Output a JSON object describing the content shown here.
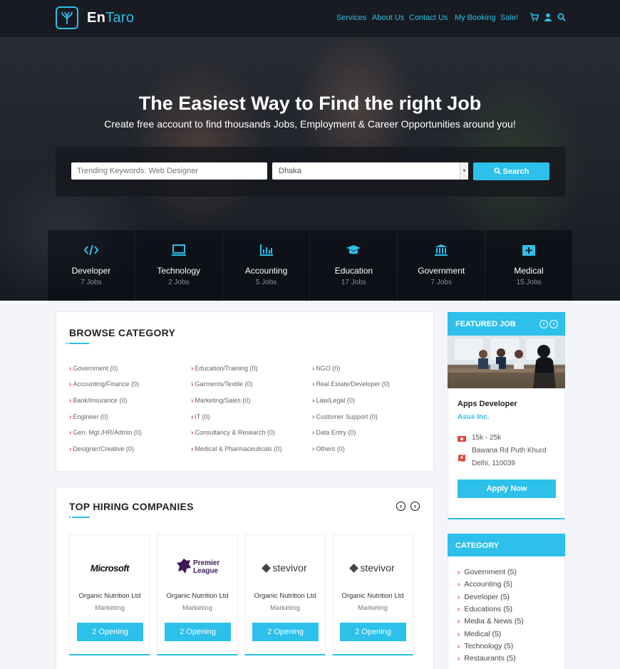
{
  "nav": {
    "brand_part1": "En",
    "brand_part2": "Taro",
    "menu": [
      "Services",
      "About Us",
      "Contact Us",
      "My Booking",
      "Sale!"
    ],
    "icons": [
      "cart-icon",
      "user-icon",
      "search-icon"
    ]
  },
  "hero": {
    "title": "The Easiest Way to Find the right Job",
    "subtitle": "Create free account to find thousands Jobs, Employment & Career Opportunities around you!",
    "keyword_placeholder": "Trending Keywords: Web Designer",
    "location_value": "Dhaka",
    "search_label": "Search"
  },
  "job_categories": [
    {
      "name": "Developer",
      "count": "7 Jobs",
      "icon": "code-icon"
    },
    {
      "name": "Technology",
      "count": "2 Jobs",
      "icon": "monitor-icon"
    },
    {
      "name": "Accounting",
      "count": "5 Jobs",
      "icon": "chart-icon"
    },
    {
      "name": "Education",
      "count": "17 Jobs",
      "icon": "graduation-cap-icon"
    },
    {
      "name": "Government",
      "count": "7 Jobs",
      "icon": "bank-icon"
    },
    {
      "name": "Medical",
      "count": "15 Jobs",
      "icon": "medical-kit-icon"
    }
  ],
  "browse": {
    "title": "BROWSE CATEGORY",
    "columns": [
      [
        "Government (0)",
        "Accounting/Finance (0)",
        "Bank/Insurance (0)",
        "Engineer (0)",
        "Gen. Mgt./HR/Admin (0)",
        "Designer/Creative (0)"
      ],
      [
        "Education/Training (0)",
        "Garments/Textile (0)",
        "Marketing/Sales (0)",
        "IT (0)",
        "Consultancy & Research (0)",
        "Medical & Pharmaceuticals (0)"
      ],
      [
        "NGO (0)",
        "Real Estate/Developer (0)",
        "Law/Legal (0)",
        "Customer Support (0)",
        "Data Entry (0)",
        "Others (0)"
      ]
    ]
  },
  "companies": {
    "title": "TOP HIRING COMPANIES",
    "items": [
      {
        "logo": "Microsoft",
        "name": "Organic Nutrition Ltd",
        "dept": "Marketing",
        "button": "2 Opening"
      },
      {
        "logo": "Premier League",
        "name": "Organic Nutrition Ltd",
        "dept": "Marketing",
        "button": "2 Opening"
      },
      {
        "logo": "stevivor",
        "name": "Organic Nutrition Ltd",
        "dept": "Marketing",
        "button": "2 Opening"
      },
      {
        "logo": "stevivor",
        "name": "Organic Nutrition Ltd",
        "dept": "Marketing",
        "button": "2 Opening"
      }
    ]
  },
  "featured": {
    "title": "FEATURED JOB",
    "job_title": "Apps Developer",
    "company": "Asus Inc.",
    "salary": "15k - 25k",
    "address_line1": "Bawana Rd Puth Khurd",
    "address_line2": "Delhi, 110039",
    "apply_label": "Apply Now"
  },
  "sidebar_category": {
    "title": "CATEGORY",
    "items": [
      "Government (5)",
      "Accounting (5)",
      "Developer (5)",
      "Educations (5)",
      "Media & News (5)",
      "Medical (5)",
      "Technology (5)",
      "Restaurants (5)"
    ]
  },
  "colors": {
    "accent": "#2cc0ea",
    "chevron": "#e0463a"
  }
}
